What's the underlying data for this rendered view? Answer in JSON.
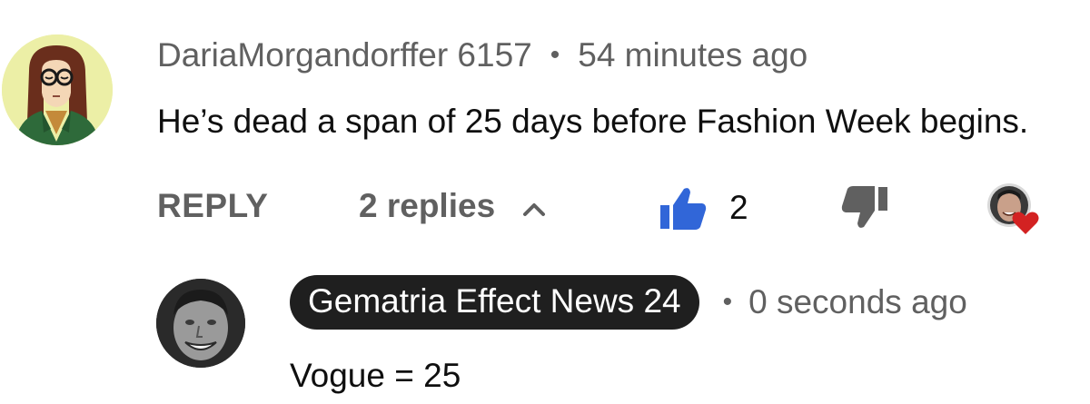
{
  "comment": {
    "author": "DariaMorgandorffer 6157",
    "separator": "•",
    "time": "54 minutes ago",
    "text": "He’s dead a span of 25 days before Fashion Week begins.",
    "actions": {
      "reply_label": "REPLY",
      "replies_label": "2 replies",
      "like_count": "2",
      "like_icon": "thumbs-up-icon",
      "dislike_icon": "thumbs-down-icon",
      "creator_heart_icon": "creator-heart-icon"
    },
    "colors": {
      "like_active": "#3166d8",
      "heart": "#d32222",
      "avatar_bg": "#ecefa6"
    }
  },
  "reply": {
    "author": "Gematria Effect News 24",
    "separator": "•",
    "time": "0 seconds ago",
    "text": "Vogue = 25",
    "colors": {
      "badge_bg": "#1f1f1f",
      "badge_text": "#ffffff"
    }
  }
}
